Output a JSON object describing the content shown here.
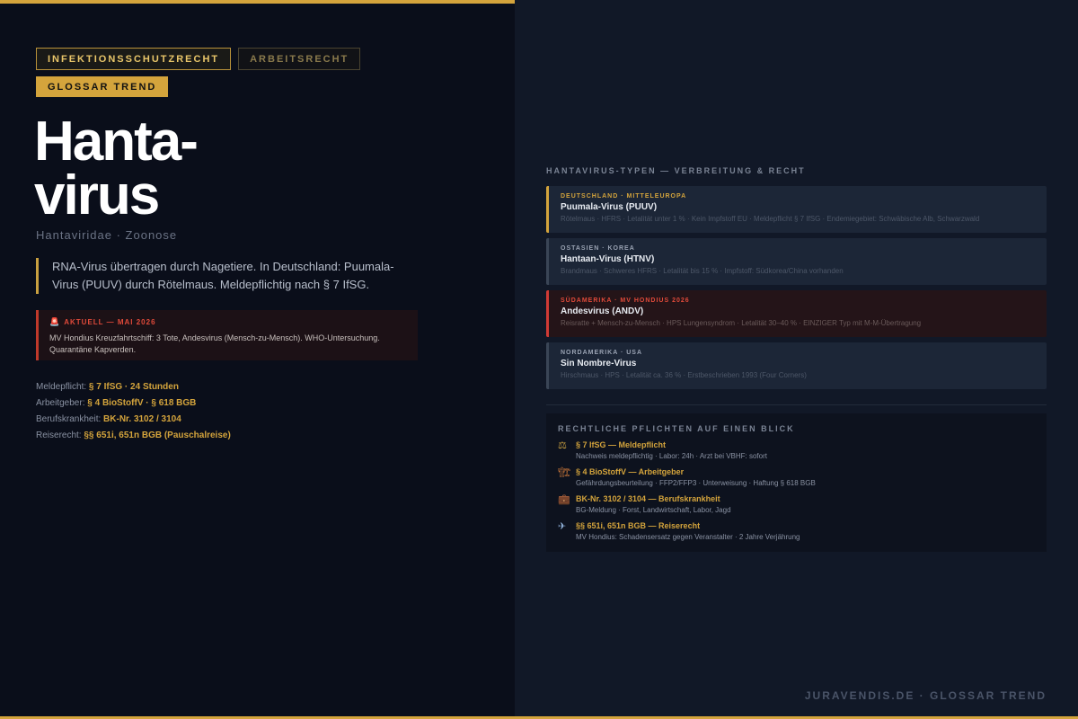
{
  "tags": {
    "primary": "INFEKTIONSSCHUTZRECHT",
    "secondary": "ARBEITSRECHT",
    "trend": "GLOSSAR TREND"
  },
  "title_line1": "Hanta-",
  "title_line2": "virus",
  "subtitle": "Hantaviridae · Zoonose",
  "intro": "RNA-Virus übertragen durch Nagetiere. In Deutschland: Puumala-Virus (PUUV) durch Rötelmaus. Meldepflichtig nach § 7 IfSG.",
  "alert": {
    "icon": "siren-icon",
    "label": "AKTUELL — MAI 2026",
    "text": "MV Hondius Kreuzfahrtschiff: 3 Tote, Andesvirus (Mensch-zu-Mensch). WHO-Untersuchung. Quarantäne Kapverden."
  },
  "facts": [
    {
      "label": "Meldepflicht:",
      "value": "§ 7 IfSG · 24 Stunden"
    },
    {
      "label": "Arbeitgeber:",
      "value": "§ 4 BioStoffV · § 618 BGB"
    },
    {
      "label": "Berufskrankheit:",
      "value": "BK-Nr. 3102 / 3104"
    },
    {
      "label": "Reiserecht:",
      "value": "§§ 651i, 651n BGB (Pauschalreise)"
    }
  ],
  "types_heading": "HANTAVIRUS-TYPEN — VERBREITUNG & RECHT",
  "types": [
    {
      "region": "DEUTSCHLAND · MITTELEUROPA",
      "name": "Puumala-Virus (PUUV)",
      "desc": "Rötelmaus · HFRS · Letalität unter 1 % · Kein Impfstoff EU · Meldepflicht § 7 IfSG · Endemiegebiet: Schwäbische Alb, Schwarzwald"
    },
    {
      "region": "OSTASIEN · KOREA",
      "name": "Hantaan-Virus (HTNV)",
      "desc": "Brandmaus · Schweres HFRS · Letalität bis 15 % · Impfstoff: Südkorea/China vorhanden"
    },
    {
      "region": "SÜDAMERIKA · MV HONDIUS 2026",
      "name": "Andesvirus (ANDV)",
      "desc": "Reisratte + Mensch-zu-Mensch · HPS Lungensyndrom · Letalität 30–40 % · EINZIGER Typ mit M-M-Übertragung"
    },
    {
      "region": "NORDAMERIKA · USA",
      "name": "Sin Nombre-Virus",
      "desc": "Hirschmaus · HPS · Letalität ca. 36 % · Erstbeschrieben 1993 (Four Corners)"
    }
  ],
  "duties_heading": "RECHTLICHE PFLICHTEN AUF EINEN BLICK",
  "duties": [
    {
      "icon": "scales-icon",
      "glyph": "⚖",
      "title": "§ 7 IfSG — Meldepflicht",
      "sub": "Nachweis meldepflichtig · Labor: 24h · Arzt bei VBHF: sofort"
    },
    {
      "icon": "crane-icon",
      "glyph": "🏗",
      "title": "§ 4 BioStoffV — Arbeitgeber",
      "sub": "Gefährdungsbeurteilung · FFP2/FFP3 · Unterweisung · Haftung § 618 BGB"
    },
    {
      "icon": "briefcase-icon",
      "glyph": "💼",
      "title": "BK-Nr. 3102 / 3104 — Berufskrankheit",
      "sub": "BG-Meldung · Forst, Landwirtschaft, Labor, Jagd"
    },
    {
      "icon": "airplane-icon",
      "glyph": "✈",
      "title": "§§ 651i, 651n BGB — Reiserecht",
      "sub": "MV Hondius: Schadensersatz gegen Veranstalter · 2 Jahre Verjährung"
    }
  ],
  "footer": "JURAVENDIS.DE · GLOSSAR TREND",
  "colors": {
    "accent": "#d4a43c",
    "alert": "#e04a3a",
    "bg_left": "#0a0e1a",
    "bg_right": "#111827"
  }
}
